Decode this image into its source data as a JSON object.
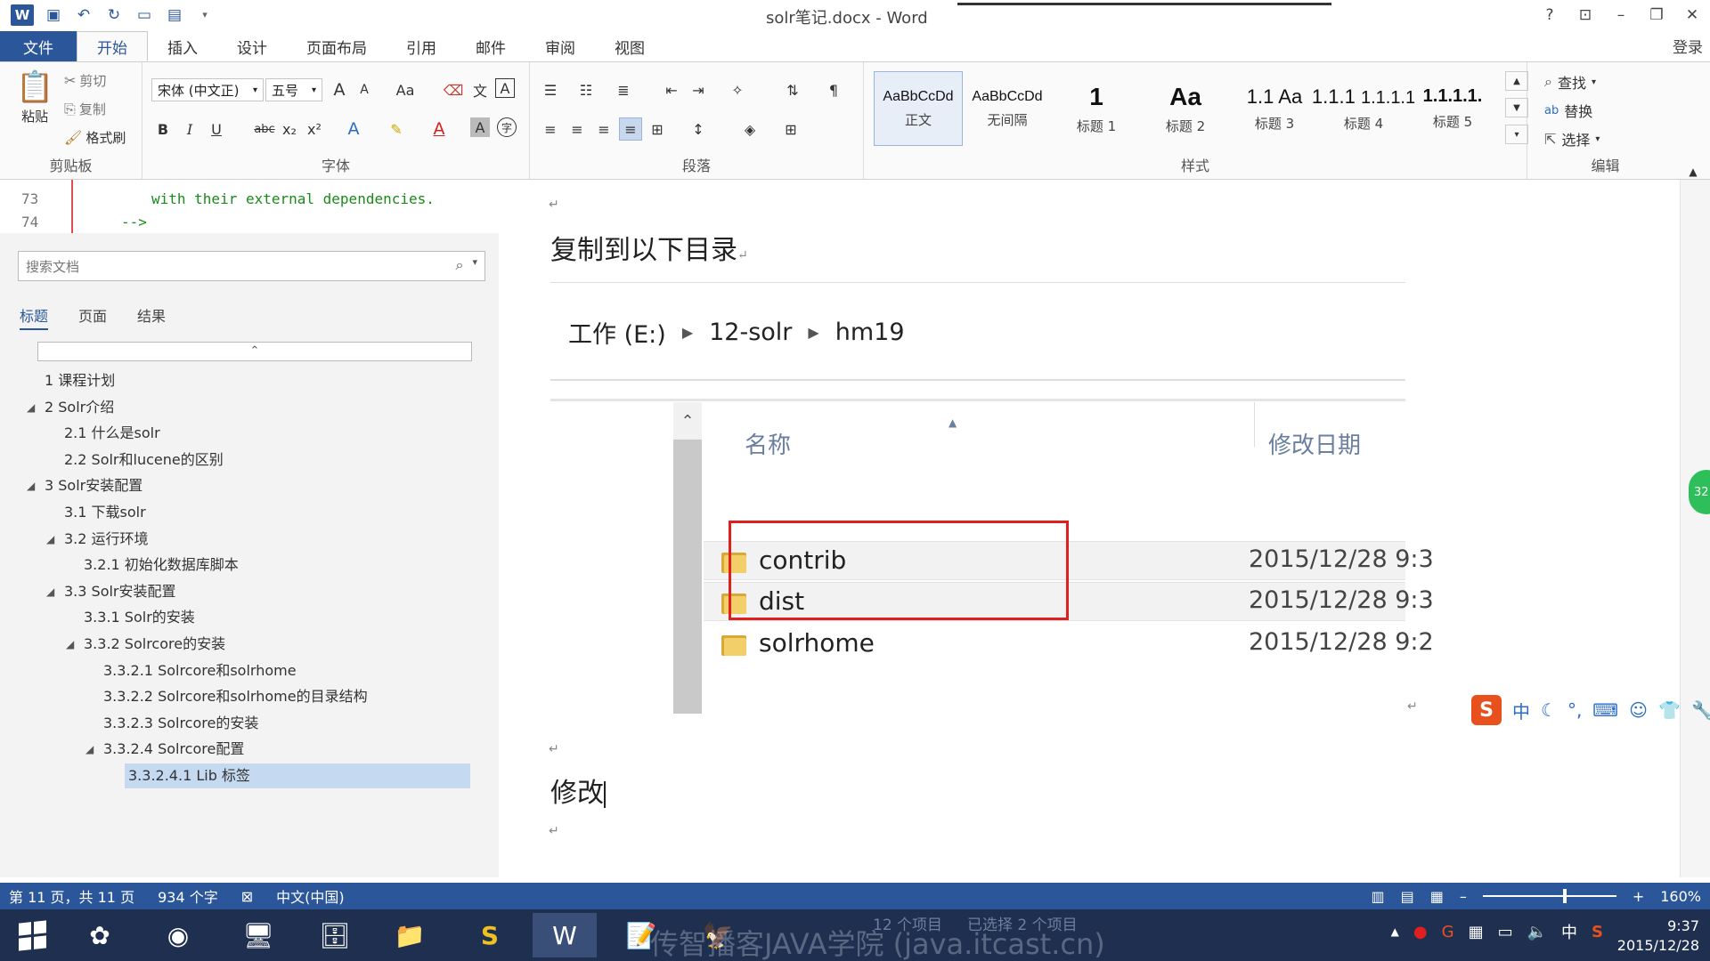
{
  "window": {
    "title": "solr笔记.docx - Word",
    "help": "?",
    "login": "登录"
  },
  "ribbon_tabs": [
    "文件",
    "开始",
    "插入",
    "设计",
    "页面布局",
    "引用",
    "邮件",
    "审阅",
    "视图"
  ],
  "clipboard": {
    "paste": "粘贴",
    "cut": "剪切",
    "copy": "复制",
    "format_painter": "格式刷",
    "label": "剪贴板"
  },
  "font": {
    "name": "宋体 (中文正)",
    "size": "五号",
    "label": "字体",
    "grow": "A",
    "shrink": "A",
    "case": "Aa",
    "bold": "B",
    "italic": "I",
    "underline": "U",
    "strike": "abc",
    "sub": "x₂",
    "sup": "x²"
  },
  "paragraph": {
    "label": "段落"
  },
  "styles": {
    "label": "样式",
    "items": [
      {
        "sample": "AaBbCcDd",
        "name": "正文"
      },
      {
        "sample": "AaBbCcDd",
        "name": "无间隔"
      },
      {
        "sample": "1",
        "name": "标题 1"
      },
      {
        "sample": "Aa",
        "name": "标题 2"
      },
      {
        "sample": "1.1",
        "name": "标题 3"
      },
      {
        "sample": "Aa",
        "name": "标题 4"
      },
      {
        "sample": "1.1.1",
        "name": "标题 5"
      }
    ],
    "visible_names": [
      "正文",
      "无间隔",
      "标题 1",
      "标题 2",
      "标题 3",
      "标题 4",
      "标题 5"
    ],
    "visible_samples": [
      "AaBbCcDd",
      "AaBbCcDd",
      "1",
      "Aa",
      "1.1",
      "Aa",
      "1.1.1",
      "1.1.1.1",
      "1.1.1.1."
    ]
  },
  "editing": {
    "label": "编辑",
    "find": "查找",
    "replace": "替换",
    "select": "选择"
  },
  "code_peek": [
    {
      "num": "73",
      "text": "with their external dependencies."
    },
    {
      "num": "74",
      "text": "-->"
    }
  ],
  "nav": {
    "search_placeholder": "搜索文档",
    "tabs": [
      "标题",
      "页面",
      "结果"
    ],
    "headings": [
      {
        "text": "1 课程计划",
        "level": 0,
        "expand": ""
      },
      {
        "text": "2 Solr介绍",
        "level": 0,
        "expand": "◢"
      },
      {
        "text": "2.1 什么是solr",
        "level": 1,
        "expand": ""
      },
      {
        "text": "2.2 Solr和lucene的区别",
        "level": 1,
        "expand": ""
      },
      {
        "text": "3 Solr安装配置",
        "level": 0,
        "expand": "◢"
      },
      {
        "text": "3.1 下载solr",
        "level": 1,
        "expand": ""
      },
      {
        "text": "3.2 运行环境",
        "level": 1,
        "expand": "◢"
      },
      {
        "text": "3.2.1 初始化数据库脚本",
        "level": 2,
        "expand": ""
      },
      {
        "text": "3.3 Solr安装配置",
        "level": 1,
        "expand": "◢"
      },
      {
        "text": "3.3.1 Solr的安装",
        "level": 2,
        "expand": ""
      },
      {
        "text": "3.3.2 Solrcore的安装",
        "level": 2,
        "expand": "◢"
      },
      {
        "text": "3.3.2.1 Solrcore和solrhome",
        "level": 3,
        "expand": ""
      },
      {
        "text": "3.3.2.2 Solrcore和solrhome的目录结构",
        "level": 3,
        "expand": ""
      },
      {
        "text": "3.3.2.3 Solrcore的安装",
        "level": 3,
        "expand": ""
      },
      {
        "text": "3.3.2.4 Solrcore配置",
        "level": 3,
        "expand": "◢"
      },
      {
        "text": "3.3.2.4.1 Lib 标签",
        "level": 4,
        "expand": "",
        "selected": true
      }
    ]
  },
  "document": {
    "heading1": "复制到以下目录",
    "heading2": "修改",
    "explorer": {
      "breadcrumb": [
        "工作 (E:)",
        "12-solr",
        "hm19"
      ],
      "col_name": "名称",
      "col_date": "修改日期",
      "rows": [
        {
          "name": "contrib",
          "date": "2015/12/28 9:3"
        },
        {
          "name": "dist",
          "date": "2015/12/28 9:3"
        },
        {
          "name": "solrhome",
          "date": "2015/12/28 9:2"
        }
      ]
    }
  },
  "badge": "32",
  "ime": {
    "logo": "S",
    "lang": "中"
  },
  "status": {
    "page": "第 11 页，共 11 页",
    "words": "934 个字",
    "language": "中文(中国)",
    "zoom": "160%",
    "zoom_level": 0.6
  },
  "taskbar": {
    "faint_items": "12 个项目",
    "faint_selected": "已选择 2 个项目",
    "watermark": "传智播客JAVA学院 (java.itcast.cn)",
    "time": "9:37",
    "date": "2015/12/28",
    "tray_lang": "中"
  },
  "colors": {
    "accent": "#2b579a",
    "highlight_box": "#e02020",
    "selected_heading": "#c5d9f1"
  }
}
